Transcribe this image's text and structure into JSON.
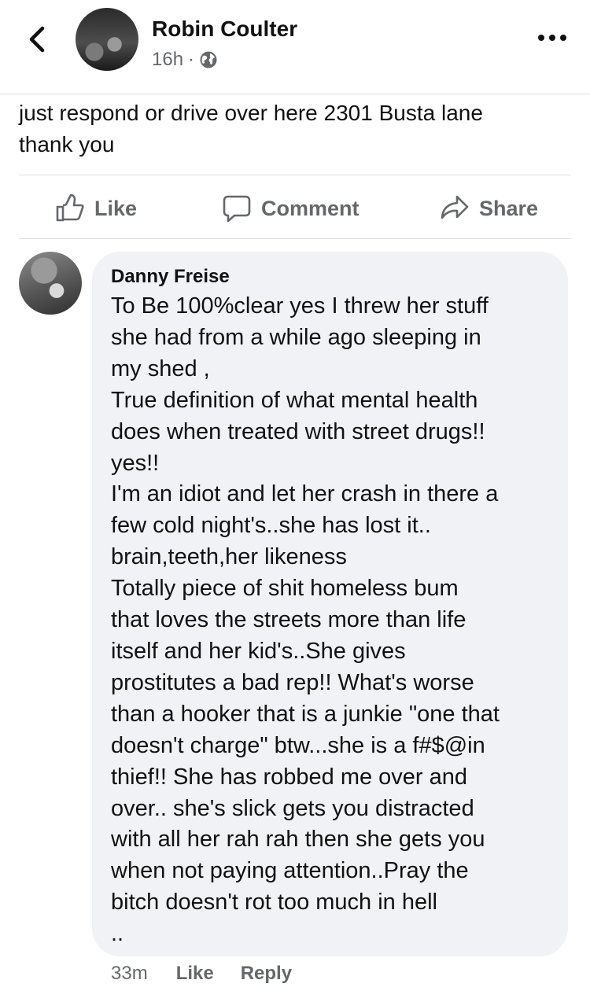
{
  "post": {
    "author": "Robin Coulter",
    "time": "16h",
    "separator": "·",
    "text_lines": [
      "just respond or drive over here 2301 Busta lane",
      "thank you"
    ]
  },
  "icons": {
    "back": "chevron-left-icon",
    "more": "more-horizontal-icon",
    "privacy": "globe-icon",
    "like": "thumbs-up-icon",
    "comment": "speech-bubble-icon",
    "share": "share-arrow-icon"
  },
  "actions": {
    "like_label": "Like",
    "comment_label": "Comment",
    "share_label": "Share"
  },
  "comment": {
    "author": "Danny Freise",
    "lines": [
      "To Be 100%clear yes I threw her stuff",
      "she had from a while ago  sleeping in",
      "my shed ,",
      "True definition of what mental health",
      "does when treated with street drugs!!",
      "yes!!",
      "I'm an idiot and let her crash in there a",
      "few cold night's..she has lost it..",
      "brain,teeth,her likeness",
      "Totally piece of shit homeless bum",
      "that loves the streets more than life",
      "itself and her kid's..She gives",
      "prostitutes a bad rep!! What's worse",
      "than a hooker that is a junkie \"one that",
      "doesn't charge\" btw...she is a f#$@in",
      "thief!! She has robbed me over and",
      "over.. she's slick gets you distracted",
      "with all her rah rah then she gets you",
      "when not paying attention..Pray the",
      "bitch doesn't rot too much in hell",
      ".."
    ],
    "time": "33m",
    "like_label": "Like",
    "reply_label": "Reply"
  },
  "colors": {
    "secondary_text": "#65676b",
    "bubble_bg": "#f0f2f5",
    "divider": "#dddfe2"
  }
}
